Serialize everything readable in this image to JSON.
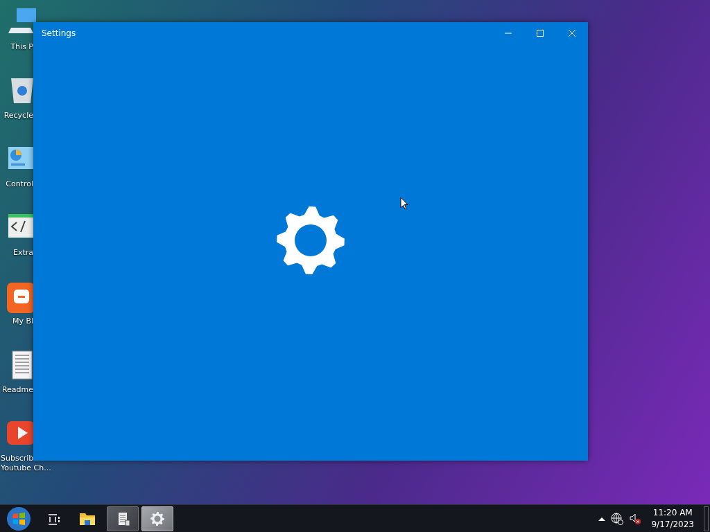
{
  "desktop_icons": [
    {
      "kind": "computer",
      "lines": [
        "This P"
      ]
    },
    {
      "kind": "recycle-bin",
      "lines": [
        "Recycle"
      ]
    },
    {
      "kind": "control-panel",
      "lines": [
        "Control"
      ]
    },
    {
      "kind": "code",
      "lines": [
        "Extra"
      ]
    },
    {
      "kind": "blog",
      "lines": [
        "My Bl"
      ]
    },
    {
      "kind": "document",
      "lines": [
        "Readme"
      ]
    },
    {
      "kind": "video",
      "lines": [
        "Subscrib",
        "Youtube Ch..."
      ]
    }
  ],
  "window": {
    "title": "Settings"
  },
  "taskbar": {
    "items": [
      {
        "kind": "start"
      },
      {
        "kind": "task-view"
      },
      {
        "kind": "folder"
      },
      {
        "kind": "document-app",
        "selected": false
      },
      {
        "kind": "gear",
        "selected": true
      }
    ],
    "tray": {
      "time": "11:20 AM",
      "date": "9/17/2023"
    }
  }
}
